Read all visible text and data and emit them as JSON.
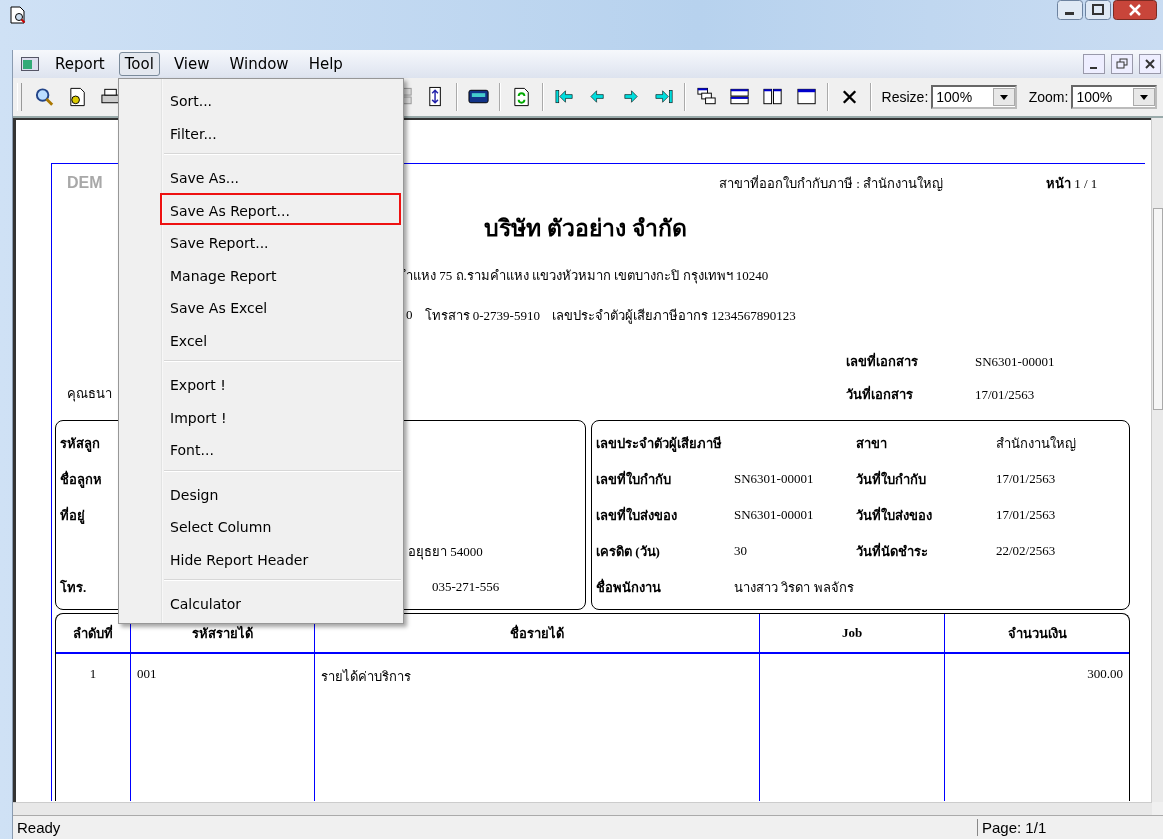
{
  "menu_bar": {
    "items": [
      {
        "label": "Report",
        "selected": false
      },
      {
        "label": "Tool",
        "selected": true
      },
      {
        "label": "View",
        "selected": false
      },
      {
        "label": "Window",
        "selected": false
      },
      {
        "label": "Help",
        "selected": false
      }
    ]
  },
  "toolbar": {
    "resize": {
      "label": "Resize:",
      "value": "100%"
    },
    "zoom": {
      "label": "Zoom:",
      "value": "100%"
    }
  },
  "tool_menu": {
    "groups": [
      [
        {
          "label": "Sort...",
          "highlighted": false
        },
        {
          "label": "Filter...",
          "highlighted": false
        }
      ],
      [
        {
          "label": "Save As...",
          "highlighted": false
        },
        {
          "label": "Save As Report...",
          "highlighted": true
        },
        {
          "label": "Save Report...",
          "highlighted": false
        },
        {
          "label": "Manage Report",
          "highlighted": false
        },
        {
          "label": "Save As Excel",
          "highlighted": false
        },
        {
          "label": "Excel",
          "highlighted": false
        }
      ],
      [
        {
          "label": "Export !",
          "highlighted": false
        },
        {
          "label": "Import !",
          "highlighted": false
        },
        {
          "label": "Font...",
          "highlighted": false
        }
      ],
      [
        {
          "label": "Design",
          "highlighted": false
        },
        {
          "label": "Select Column",
          "highlighted": false
        },
        {
          "label": "Hide Report Header",
          "highlighted": false
        }
      ],
      [
        {
          "label": "Calculator",
          "highlighted": false
        }
      ]
    ]
  },
  "report": {
    "demo_label": "DEM",
    "branch_line": "สาขาที่ออกใบกำกับภาษี : สำนักงานใหญ่",
    "page": "**หน้า** 1 / 1",
    "company": "บริษัท ตัวอย่าง จำกัด",
    "address": "ำแหง 75 ถ.รามคำแหง แขวงหัวหมาก เขตบางกะปิ กรุงเทพฯ 10240",
    "contact": [
      "0",
      "โทรสาร 0-2739-5910",
      "เลขประจำตัวผู้เสียภาษีอากร 1234567890123"
    ],
    "recipient": "คุณธนา",
    "doc_fields": [
      {
        "label": "เลขที่เอกสาร",
        "value": "SN6301-00001"
      },
      {
        "label": "วันที่เอกสาร",
        "value": "17/01/2563"
      }
    ],
    "customer_box": [
      {
        "label": "รหัสลูก"
      },
      {
        "label": "ชื่อลูกห"
      },
      {
        "label": "ที่อยู่"
      },
      {
        "value": "อยุธยา 54000"
      },
      {
        "label": "โทร.",
        "value": "035-271-556"
      }
    ],
    "invoice_box": [
      {
        "label": "เลขประจำตัวผู้เสียภาษี",
        "label_2": "สาขา",
        "value_2": "สำนักงานใหญ่"
      },
      {
        "label": "เลขที่ใบกำกับ",
        "value": "SN6301-00001",
        "label_2": "วันที่ใบกำกับ",
        "value_2": "17/01/2563"
      },
      {
        "label": "เลขที่ใบส่งของ",
        "value": "SN6301-00001",
        "label_2": "วันที่ใบส่งของ",
        "value_2": "17/01/2563"
      },
      {
        "label": "เครดิต (วัน)",
        "value": "30",
        "label_2": "วันที่นัดชำระ",
        "value_2": "22/02/2563"
      },
      {
        "label": "ชื่อพนักงาน",
        "value": "นางสาว วิรดา  พลจักร"
      }
    ],
    "table": {
      "columns": [
        "ลำดับที่",
        "รหัสรายได้",
        "ชื่อรายได้",
        "Job",
        "จำนวนเงิน"
      ],
      "rows": [
        [
          "1",
          "001",
          "รายได้ค่าบริการ",
          null,
          "300.00"
        ]
      ]
    }
  },
  "status_bar": {
    "text": "Ready",
    "page": "Page: 1/1"
  }
}
